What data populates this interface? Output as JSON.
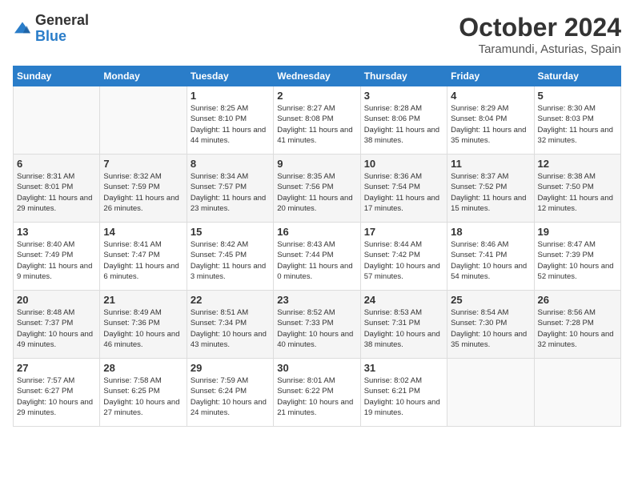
{
  "logo": {
    "general": "General",
    "blue": "Blue"
  },
  "title": "October 2024",
  "subtitle": "Taramundi, Asturias, Spain",
  "days_of_week": [
    "Sunday",
    "Monday",
    "Tuesday",
    "Wednesday",
    "Thursday",
    "Friday",
    "Saturday"
  ],
  "weeks": [
    [
      {
        "day": "",
        "sunrise": "",
        "sunset": "",
        "daylight": "",
        "empty": true
      },
      {
        "day": "",
        "sunrise": "",
        "sunset": "",
        "daylight": "",
        "empty": true
      },
      {
        "day": "1",
        "sunrise": "Sunrise: 8:25 AM",
        "sunset": "Sunset: 8:10 PM",
        "daylight": "Daylight: 11 hours and 44 minutes."
      },
      {
        "day": "2",
        "sunrise": "Sunrise: 8:27 AM",
        "sunset": "Sunset: 8:08 PM",
        "daylight": "Daylight: 11 hours and 41 minutes."
      },
      {
        "day": "3",
        "sunrise": "Sunrise: 8:28 AM",
        "sunset": "Sunset: 8:06 PM",
        "daylight": "Daylight: 11 hours and 38 minutes."
      },
      {
        "day": "4",
        "sunrise": "Sunrise: 8:29 AM",
        "sunset": "Sunset: 8:04 PM",
        "daylight": "Daylight: 11 hours and 35 minutes."
      },
      {
        "day": "5",
        "sunrise": "Sunrise: 8:30 AM",
        "sunset": "Sunset: 8:03 PM",
        "daylight": "Daylight: 11 hours and 32 minutes."
      }
    ],
    [
      {
        "day": "6",
        "sunrise": "Sunrise: 8:31 AM",
        "sunset": "Sunset: 8:01 PM",
        "daylight": "Daylight: 11 hours and 29 minutes."
      },
      {
        "day": "7",
        "sunrise": "Sunrise: 8:32 AM",
        "sunset": "Sunset: 7:59 PM",
        "daylight": "Daylight: 11 hours and 26 minutes."
      },
      {
        "day": "8",
        "sunrise": "Sunrise: 8:34 AM",
        "sunset": "Sunset: 7:57 PM",
        "daylight": "Daylight: 11 hours and 23 minutes."
      },
      {
        "day": "9",
        "sunrise": "Sunrise: 8:35 AM",
        "sunset": "Sunset: 7:56 PM",
        "daylight": "Daylight: 11 hours and 20 minutes."
      },
      {
        "day": "10",
        "sunrise": "Sunrise: 8:36 AM",
        "sunset": "Sunset: 7:54 PM",
        "daylight": "Daylight: 11 hours and 17 minutes."
      },
      {
        "day": "11",
        "sunrise": "Sunrise: 8:37 AM",
        "sunset": "Sunset: 7:52 PM",
        "daylight": "Daylight: 11 hours and 15 minutes."
      },
      {
        "day": "12",
        "sunrise": "Sunrise: 8:38 AM",
        "sunset": "Sunset: 7:50 PM",
        "daylight": "Daylight: 11 hours and 12 minutes."
      }
    ],
    [
      {
        "day": "13",
        "sunrise": "Sunrise: 8:40 AM",
        "sunset": "Sunset: 7:49 PM",
        "daylight": "Daylight: 11 hours and 9 minutes."
      },
      {
        "day": "14",
        "sunrise": "Sunrise: 8:41 AM",
        "sunset": "Sunset: 7:47 PM",
        "daylight": "Daylight: 11 hours and 6 minutes."
      },
      {
        "day": "15",
        "sunrise": "Sunrise: 8:42 AM",
        "sunset": "Sunset: 7:45 PM",
        "daylight": "Daylight: 11 hours and 3 minutes."
      },
      {
        "day": "16",
        "sunrise": "Sunrise: 8:43 AM",
        "sunset": "Sunset: 7:44 PM",
        "daylight": "Daylight: 11 hours and 0 minutes."
      },
      {
        "day": "17",
        "sunrise": "Sunrise: 8:44 AM",
        "sunset": "Sunset: 7:42 PM",
        "daylight": "Daylight: 10 hours and 57 minutes."
      },
      {
        "day": "18",
        "sunrise": "Sunrise: 8:46 AM",
        "sunset": "Sunset: 7:41 PM",
        "daylight": "Daylight: 10 hours and 54 minutes."
      },
      {
        "day": "19",
        "sunrise": "Sunrise: 8:47 AM",
        "sunset": "Sunset: 7:39 PM",
        "daylight": "Daylight: 10 hours and 52 minutes."
      }
    ],
    [
      {
        "day": "20",
        "sunrise": "Sunrise: 8:48 AM",
        "sunset": "Sunset: 7:37 PM",
        "daylight": "Daylight: 10 hours and 49 minutes."
      },
      {
        "day": "21",
        "sunrise": "Sunrise: 8:49 AM",
        "sunset": "Sunset: 7:36 PM",
        "daylight": "Daylight: 10 hours and 46 minutes."
      },
      {
        "day": "22",
        "sunrise": "Sunrise: 8:51 AM",
        "sunset": "Sunset: 7:34 PM",
        "daylight": "Daylight: 10 hours and 43 minutes."
      },
      {
        "day": "23",
        "sunrise": "Sunrise: 8:52 AM",
        "sunset": "Sunset: 7:33 PM",
        "daylight": "Daylight: 10 hours and 40 minutes."
      },
      {
        "day": "24",
        "sunrise": "Sunrise: 8:53 AM",
        "sunset": "Sunset: 7:31 PM",
        "daylight": "Daylight: 10 hours and 38 minutes."
      },
      {
        "day": "25",
        "sunrise": "Sunrise: 8:54 AM",
        "sunset": "Sunset: 7:30 PM",
        "daylight": "Daylight: 10 hours and 35 minutes."
      },
      {
        "day": "26",
        "sunrise": "Sunrise: 8:56 AM",
        "sunset": "Sunset: 7:28 PM",
        "daylight": "Daylight: 10 hours and 32 minutes."
      }
    ],
    [
      {
        "day": "27",
        "sunrise": "Sunrise: 7:57 AM",
        "sunset": "Sunset: 6:27 PM",
        "daylight": "Daylight: 10 hours and 29 minutes."
      },
      {
        "day": "28",
        "sunrise": "Sunrise: 7:58 AM",
        "sunset": "Sunset: 6:25 PM",
        "daylight": "Daylight: 10 hours and 27 minutes."
      },
      {
        "day": "29",
        "sunrise": "Sunrise: 7:59 AM",
        "sunset": "Sunset: 6:24 PM",
        "daylight": "Daylight: 10 hours and 24 minutes."
      },
      {
        "day": "30",
        "sunrise": "Sunrise: 8:01 AM",
        "sunset": "Sunset: 6:22 PM",
        "daylight": "Daylight: 10 hours and 21 minutes."
      },
      {
        "day": "31",
        "sunrise": "Sunrise: 8:02 AM",
        "sunset": "Sunset: 6:21 PM",
        "daylight": "Daylight: 10 hours and 19 minutes."
      },
      {
        "day": "",
        "sunrise": "",
        "sunset": "",
        "daylight": "",
        "empty": true
      },
      {
        "day": "",
        "sunrise": "",
        "sunset": "",
        "daylight": "",
        "empty": true
      }
    ]
  ]
}
